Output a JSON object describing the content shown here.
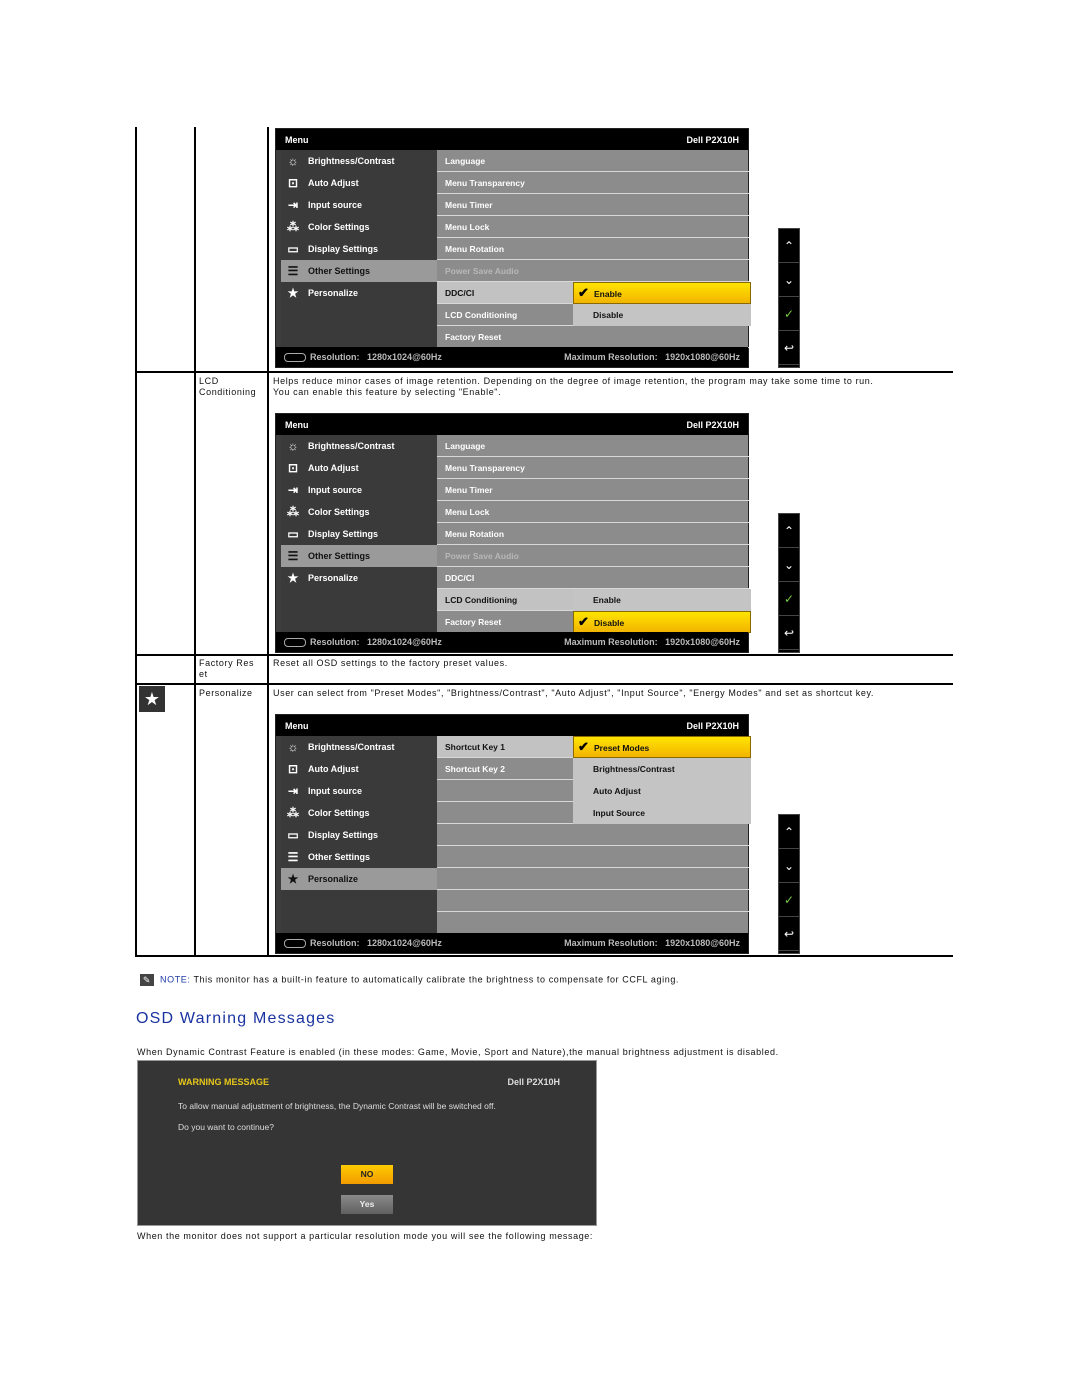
{
  "osd_common": {
    "menu_title": "Menu",
    "model": "Dell P2X10H",
    "resolution_label": "Resolution:",
    "resolution_value": "1280x1024@60Hz",
    "max_resolution_label": "Maximum Resolution:",
    "max_resolution_value": "1920x1080@60Hz",
    "left_menu": [
      {
        "label": "Brightness/Contrast",
        "icon": "brightness-icon"
      },
      {
        "label": "Auto Adjust",
        "icon": "auto-adjust-icon"
      },
      {
        "label": "Input source",
        "icon": "input-source-icon"
      },
      {
        "label": "Color Settings",
        "icon": "color-settings-icon"
      },
      {
        "label": "Display Settings",
        "icon": "display-settings-icon"
      },
      {
        "label": "Other Settings",
        "icon": "other-settings-icon"
      },
      {
        "label": "Personalize",
        "icon": "star-icon"
      }
    ],
    "other_settings_items": [
      "Language",
      "Menu Transparency",
      "Menu Timer",
      "Menu Lock",
      "Menu Rotation",
      "Power Save Audio",
      "DDC/CI",
      "LCD Conditioning",
      "Factory Reset"
    ],
    "nav_buttons": [
      "up-arrow-icon",
      "down-arrow-icon",
      "check-icon",
      "back-icon"
    ]
  },
  "osd1": {
    "selected_left": "Other Settings",
    "selected_item": "DDC/CI",
    "options": [
      "Enable",
      "Disable"
    ],
    "checked_option": "Enable"
  },
  "rows": [
    {
      "name": "LCD Conditioning",
      "description_line1": "Helps reduce minor cases of image retention. Depending on the degree of image retention, the program may take some time to run.",
      "description_line2": "You can enable this feature by selecting \"Enable\"."
    },
    {
      "name": "Factory Reset",
      "name_wrapped_1": "Factory Res",
      "name_wrapped_2": "et",
      "description": "Reset all OSD settings to the factory preset values."
    },
    {
      "name": "Personalize",
      "description": "User can select from \"Preset Modes\", \"Brightness/Contrast\", \"Auto Adjust\", \"Input Source\", \"Energy Modes\" and set as shortcut key."
    }
  ],
  "osd2": {
    "selected_left": "Other Settings",
    "selected_item": "LCD Conditioning",
    "options": [
      "Enable",
      "Disable"
    ],
    "checked_option": "Disable"
  },
  "osd3": {
    "selected_left": "Personalize",
    "items": [
      "Shortcut Key 1",
      "Shortcut Key 2"
    ],
    "selected_item": "Shortcut Key 1",
    "options": [
      "Preset Modes",
      "Brightness/Contrast",
      "Auto Adjust",
      "Input Source"
    ],
    "checked_option": "Preset Modes"
  },
  "note": {
    "label": "NOTE:",
    "text": " This monitor has a built-in feature to automatically calibrate the brightness to compensate for CCFL aging."
  },
  "warnings": {
    "title": "OSD Warning Messages",
    "intro": "When Dynamic Contrast Feature is enabled (in these modes: Game, Movie, Sport and Nature),the manual brightness adjustment is disabled.",
    "dialog": {
      "title": "WARNING MESSAGE",
      "model": "Dell P2X10H",
      "line1": "To allow manual adjustment of brightness, the Dynamic Contrast will be switched off.",
      "line2": "Do you want to continue?",
      "no_label": "NO",
      "yes_label": "Yes"
    },
    "resolution_text": "When the monitor does not support a particular resolution mode you will see the following message:"
  },
  "colors": {
    "highlight_yellow": "#ffe400",
    "title_blue": "#1a33a0",
    "ok_green": "#7ac943"
  }
}
